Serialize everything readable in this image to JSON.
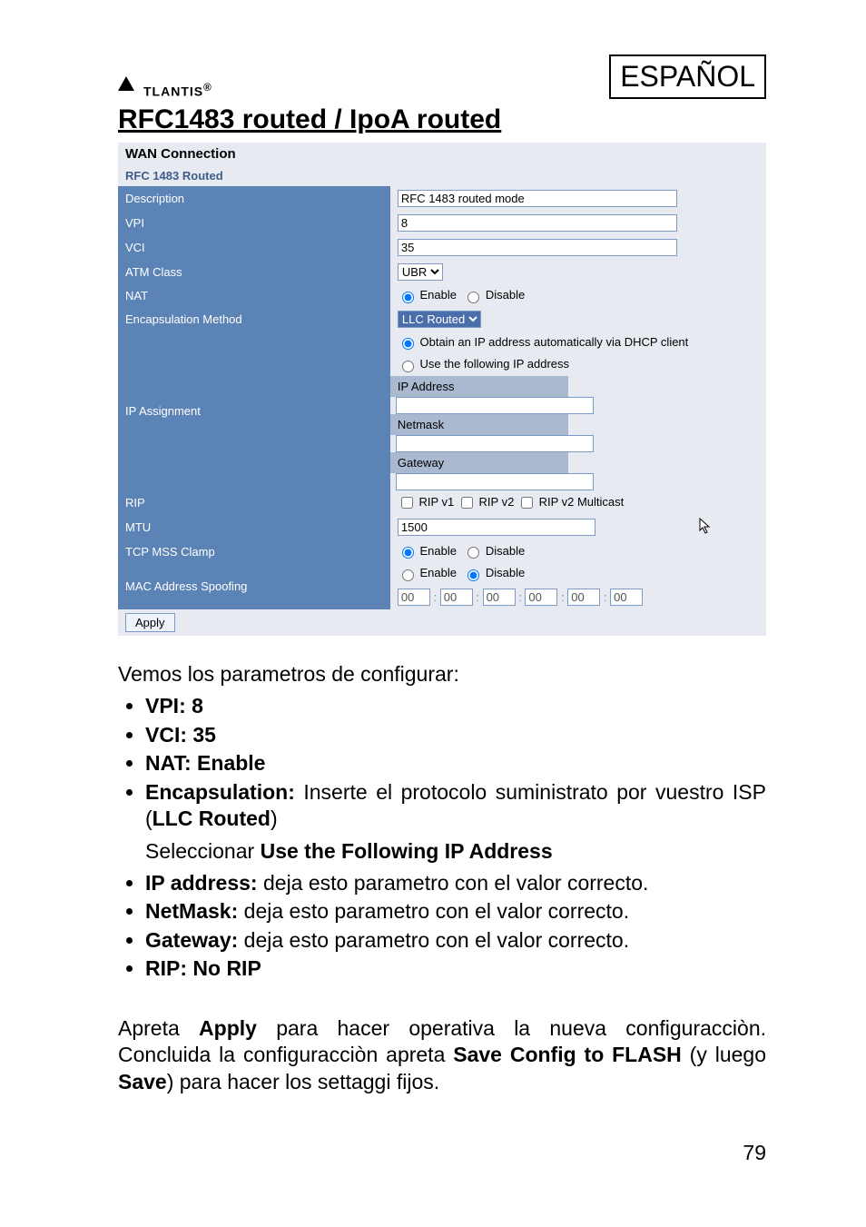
{
  "logo": "TLANTIS",
  "lang": "ESPAÑOL",
  "section_title": "RFC1483 routed / IpoA routed",
  "form": {
    "title": "WAN Connection",
    "subtitle": "RFC 1483 Routed",
    "rows": {
      "description": {
        "label": "Description",
        "value": "RFC 1483 routed mode"
      },
      "vpi": {
        "label": "VPI",
        "value": "8"
      },
      "vci": {
        "label": "VCI",
        "value": "35"
      },
      "atm": {
        "label": "ATM Class",
        "value": "UBR"
      },
      "nat": {
        "label": "NAT",
        "enable": "Enable",
        "disable": "Disable"
      },
      "encap": {
        "label": "Encapsulation Method",
        "value": "LLC Routed"
      },
      "ipassign": {
        "label": "IP Assignment",
        "auto": "Obtain an IP address automatically via DHCP client",
        "manual": "Use the following IP address",
        "ipaddr": "IP Address",
        "netmask": "Netmask",
        "gateway": "Gateway"
      },
      "rip": {
        "label": "RIP",
        "v1": "RIP v1",
        "v2": "RIP v2",
        "mc": "RIP v2 Multicast"
      },
      "mtu": {
        "label": "MTU",
        "value": "1500"
      },
      "tcpmss": {
        "label": "TCP MSS Clamp",
        "enable": "Enable",
        "disable": "Disable"
      },
      "macspoof": {
        "label": "MAC Address Spoofing",
        "enable": "Enable",
        "disable": "Disable",
        "oct": "00"
      }
    },
    "apply": "Apply"
  },
  "body": {
    "intro": "Vemos los parametros de configurar:",
    "li1a": "VPI: 8",
    "li2a": "VCI: 35",
    "li3a": "NAT: Enable",
    "li4a": "Encapsulation:",
    "li4b": " Inserte el protocolo  suministrato por vuestro ISP (",
    "li4c": "LLC Routed",
    "li4d": ")",
    "selline_a": "Seleccionar ",
    "selline_b": "Use the Following IP Address",
    "li5a": "IP address:",
    "li5b": " deja esto parametro con el valor correcto.",
    "li6a": "NetMask:",
    "li6b": " deja esto parametro con el valor correcto.",
    "li7a": "Gateway:",
    "li7b": " deja esto parametro con el valor correcto.",
    "li8a": "RIP: No RIP",
    "p2a": "Apreta ",
    "p2b": "Apply",
    "p2c": " para hacer operativa la nueva configuracciòn. Concluida la configuracciòn apreta ",
    "p2d": "Save Config to FLASH",
    "p2e": " (y luego ",
    "p2f": "Save",
    "p2g": ") para hacer los settaggi fijos."
  },
  "page_number": "79"
}
